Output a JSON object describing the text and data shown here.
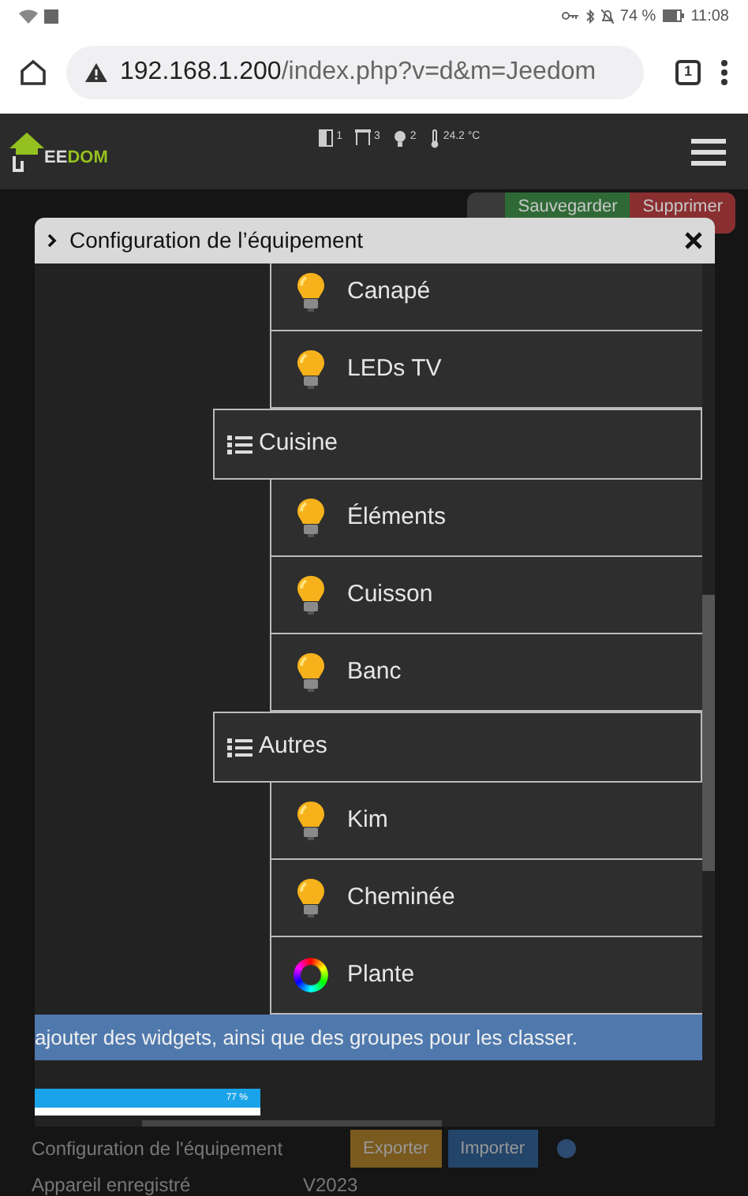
{
  "status_bar": {
    "battery": "74 %",
    "time": "11:08"
  },
  "browser": {
    "url_host": "192.168.1.200",
    "url_path": "/index.php?v=d&m=Jeedom",
    "tab_count": "1"
  },
  "app_header": {
    "logo": {
      "first": "EE",
      "second": "DOM"
    },
    "widgets": [
      {
        "kind": "door",
        "count": "1"
      },
      {
        "kind": "shutter",
        "count": "3"
      },
      {
        "kind": "light",
        "count": "2"
      },
      {
        "kind": "temperature",
        "count": "24.2 °C"
      }
    ]
  },
  "toolbar": {
    "buttons": [
      {
        "kind": "save",
        "label": "Sauvegarder"
      },
      {
        "kind": "delete",
        "label": "Supprimer"
      }
    ]
  },
  "modal": {
    "title": "Configuration de l’équipement",
    "items": [
      {
        "kind": "light",
        "label": "Canapé"
      },
      {
        "kind": "light",
        "label": "LEDs TV"
      },
      {
        "kind": "group",
        "label": "Cuisine"
      },
      {
        "kind": "light",
        "label": "Éléments"
      },
      {
        "kind": "light",
        "label": "Cuisson"
      },
      {
        "kind": "light",
        "label": "Banc"
      },
      {
        "kind": "group",
        "label": "Autres"
      },
      {
        "kind": "light",
        "label": "Kim"
      },
      {
        "kind": "light",
        "label": "Cheminée"
      },
      {
        "kind": "color",
        "label": "Plante"
      }
    ],
    "banner": "ajouter des widgets, ainsi que des groupes pour les classer.",
    "thumbnail_status": "77 %"
  },
  "page": {
    "config_row": {
      "label": "Configuration de l'équipement",
      "buttons": [
        {
          "kind": "export",
          "label": "Exporter"
        },
        {
          "kind": "import",
          "label": "Importer"
        }
      ]
    },
    "device_row": {
      "label": "Appareil enregistré",
      "value": "V2023"
    }
  }
}
